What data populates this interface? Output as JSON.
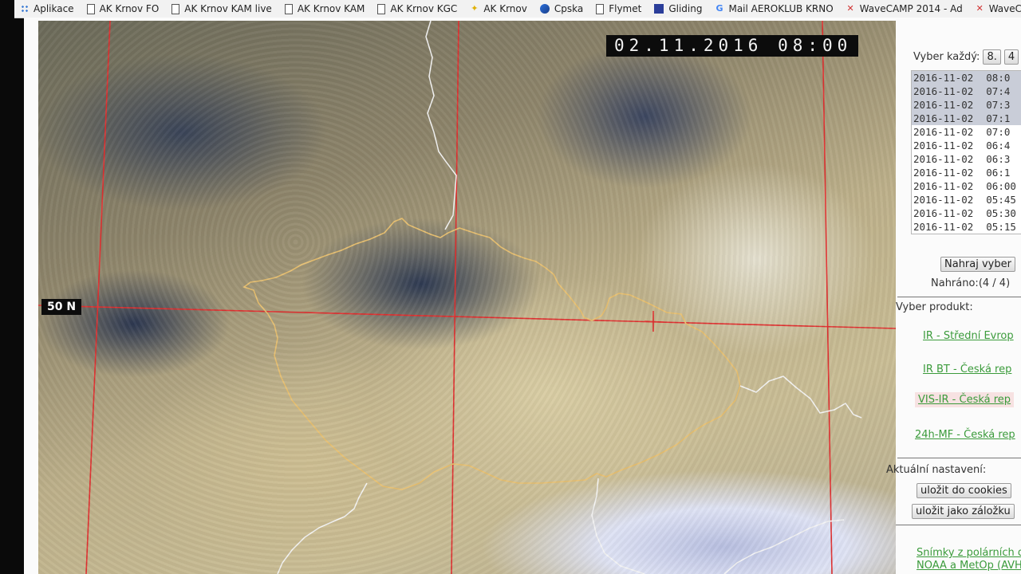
{
  "bookmarks": [
    {
      "label": "Aplikace",
      "icon": "apps-grid-icon"
    },
    {
      "label": "AK Krnov FO",
      "icon": "page-icon"
    },
    {
      "label": "AK Krnov KAM live",
      "icon": "page-icon"
    },
    {
      "label": "AK Krnov KAM",
      "icon": "page-icon"
    },
    {
      "label": "AK Krnov KGC",
      "icon": "page-icon"
    },
    {
      "label": "AK Krnov",
      "icon": "star-icon"
    },
    {
      "label": "Cpska",
      "icon": "globe-icon"
    },
    {
      "label": "Flymet",
      "icon": "page-icon"
    },
    {
      "label": "Gliding",
      "icon": "gliding-icon"
    },
    {
      "label": "Mail AEROKLUB KRNO",
      "icon": "google-icon"
    },
    {
      "label": "WaveCAMP 2014 - Ad",
      "icon": "wavecamp-icon"
    },
    {
      "label": "WaveCA",
      "icon": "wavecamp-icon"
    }
  ],
  "image": {
    "timestamp": "02.11.2016 08:00",
    "lat_label": "50 N"
  },
  "panel": {
    "vyber_label": "Vyber každý:",
    "step_options": [
      "8.",
      "4"
    ],
    "times": [
      {
        "date": "2016-11-02",
        "time": "08:0",
        "selected": true
      },
      {
        "date": "2016-11-02",
        "time": "07:4",
        "selected": true
      },
      {
        "date": "2016-11-02",
        "time": "07:3",
        "selected": true
      },
      {
        "date": "2016-11-02",
        "time": "07:1",
        "selected": true
      },
      {
        "date": "2016-11-02",
        "time": "07:0",
        "selected": false
      },
      {
        "date": "2016-11-02",
        "time": "06:4",
        "selected": false
      },
      {
        "date": "2016-11-02",
        "time": "06:3",
        "selected": false
      },
      {
        "date": "2016-11-02",
        "time": "06:1",
        "selected": false
      },
      {
        "date": "2016-11-02",
        "time": "06:00",
        "selected": false
      },
      {
        "date": "2016-11-02",
        "time": "05:45",
        "selected": false
      },
      {
        "date": "2016-11-02",
        "time": "05:30",
        "selected": false
      },
      {
        "date": "2016-11-02",
        "time": "05:15",
        "selected": false
      }
    ],
    "load_button": "Nahraj vyber",
    "loaded_text": "Nahráno:(4 / 4)",
    "product_label": "Vyber produkt:",
    "products": [
      {
        "label": "IR - Střední Evrop",
        "active": false
      },
      {
        "label": "IR BT - Česká rep",
        "active": false
      },
      {
        "label": "VIS-IR - Česká rep",
        "active": true
      },
      {
        "label": "24h-MF - Česká rep",
        "active": false
      }
    ],
    "settings_label": "Aktuální nastavení:",
    "save_cookies": "uložit do cookies",
    "save_bookmark": "uložit jako záložku",
    "footer_line1": "Snímky z polárních druž",
    "footer_line2": "NOAA a MetOp (AVHR"
  },
  "colors": {
    "grid_line": "#e03030",
    "border_yellow": "#e8c070",
    "border_white": "#f4f4f4",
    "link_green": "#3b9b3b"
  }
}
